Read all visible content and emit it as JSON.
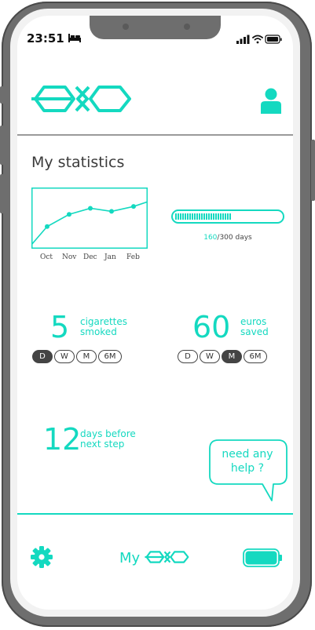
{
  "status_bar": {
    "time": "23:51"
  },
  "app": {
    "stats_title": "My statistics"
  },
  "chart_data": {
    "type": "line",
    "categories": [
      "Oct",
      "Nov",
      "Dec",
      "Jan",
      "Feb"
    ],
    "values": [
      3,
      5,
      6,
      5.5,
      6.3
    ],
    "title": "",
    "xlabel": "",
    "ylabel": "",
    "grid": false
  },
  "progress": {
    "current": "160",
    "rest": "/300 days",
    "fraction": 0.53
  },
  "cigarettes": {
    "value": "5",
    "label_line1": "cigarettes",
    "label_line2": "smoked",
    "periods": [
      "D",
      "W",
      "M",
      "6M"
    ],
    "active": 0
  },
  "euros": {
    "value": "60",
    "label_line1": "euros",
    "label_line2": "saved",
    "periods": [
      "D",
      "W",
      "M",
      "6M"
    ],
    "active": 2
  },
  "next_step": {
    "value": "12",
    "label_line1": "days before",
    "label_line2": "next step"
  },
  "help": {
    "line1": "need any",
    "line2": "help ?"
  },
  "nav": {
    "my_label": "My"
  },
  "colors": {
    "accent": "#14d9c0",
    "frame": "#6e6e6e"
  }
}
